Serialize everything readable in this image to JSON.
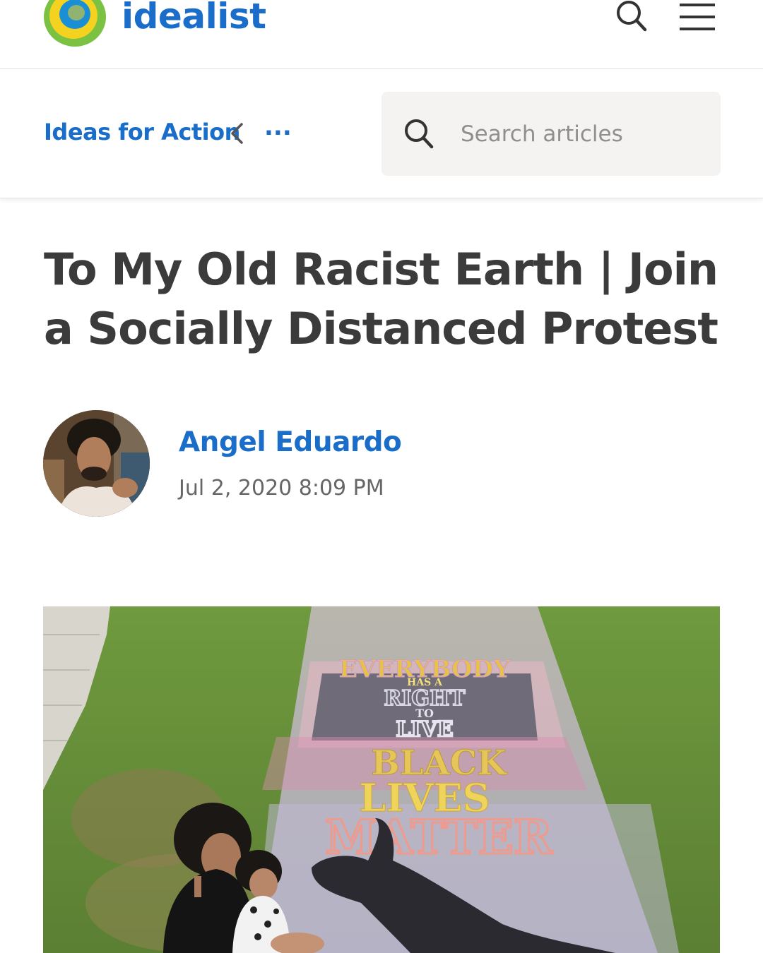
{
  "header": {
    "brand": "idealist",
    "colors": {
      "brand_blue": "#1a6ec9",
      "logo_yellow": "#f4d21f",
      "logo_green": "#7cc242"
    },
    "icons": {
      "search": "search-icon",
      "menu": "hamburger-menu-icon"
    }
  },
  "breadcrumb": {
    "link": "Ideas for Action",
    "chevron": "chevron-left-icon",
    "more": "..."
  },
  "search": {
    "placeholder": "Search articles",
    "icon": "search-icon"
  },
  "article": {
    "title": "To My Old Racist Earth | Join a Socially Distanced Protest",
    "author": "Angel Eduardo",
    "date": "Jul 2, 2020 8:09 PM",
    "chalk_text": [
      "EVERYBODY",
      "HAS A",
      "RIGHT",
      "TO",
      "LIVE",
      "BLACK",
      "LIVES",
      "MATTER"
    ]
  }
}
